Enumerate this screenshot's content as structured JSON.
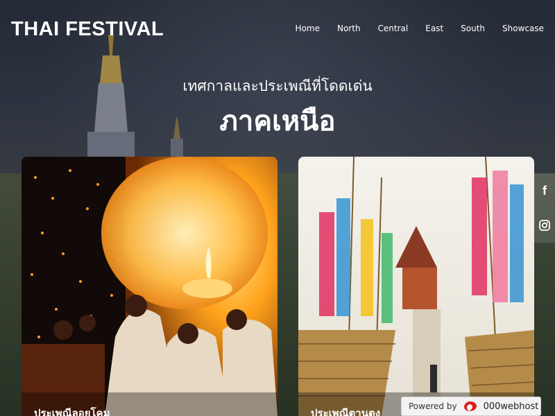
{
  "header": {
    "brand": "THAI FESTIVAL",
    "nav": [
      "Home",
      "North",
      "Central",
      "East",
      "South",
      "Showcase"
    ]
  },
  "hero": {
    "subtitle": "เทศกาลและประเพณีที่โดดเด่น",
    "title": "ภาคเหนือ"
  },
  "cards": [
    {
      "caption": "ประเพณีลอยโคม"
    },
    {
      "caption": "ประเพณีตานตุง"
    }
  ],
  "social": {
    "icons": [
      "facebook-icon",
      "instagram-icon"
    ]
  },
  "badge": {
    "powered": "Powered by",
    "host": "000webhost"
  },
  "colors": {
    "accent": "#ff9a1a",
    "lantern_glow": "#ffb43a"
  }
}
